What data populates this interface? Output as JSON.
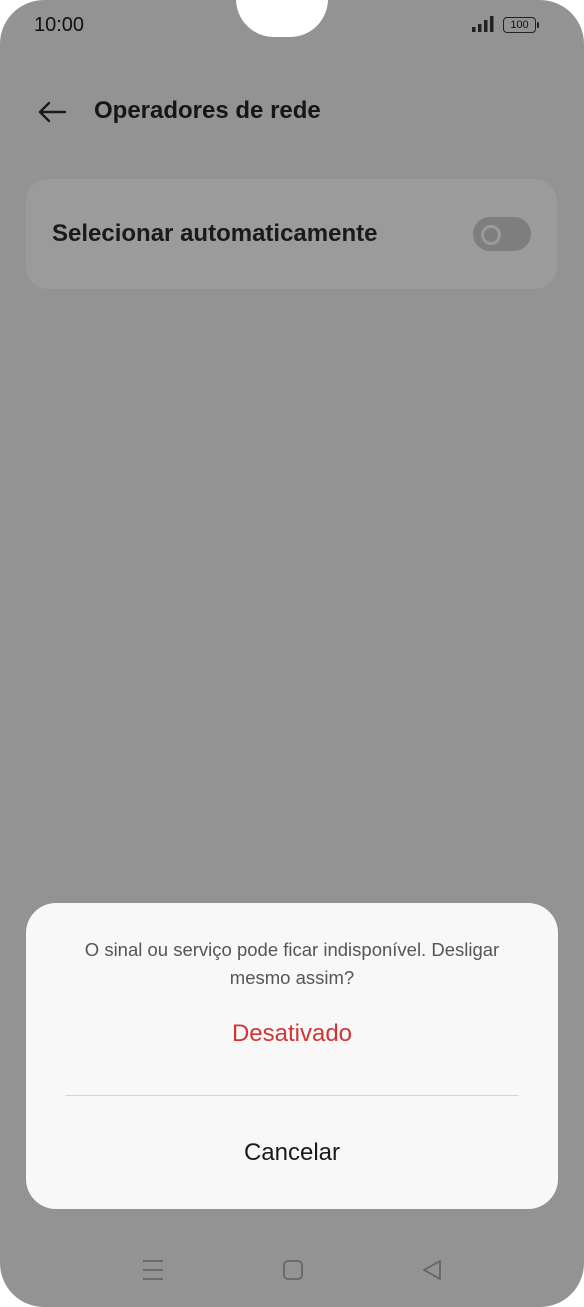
{
  "status_bar": {
    "time": "10:00",
    "battery": "100",
    "signal_icon": "signal-bars-icon"
  },
  "header": {
    "back_icon": "arrow-left-icon",
    "title": "Operadores de rede"
  },
  "setting": {
    "label": "Selecionar automaticamente",
    "toggle_on": false
  },
  "dialog": {
    "message": "O sinal ou serviço pode ficar indisponível. Desligar mesmo assim?",
    "confirm_label": "Desativado",
    "cancel_label": "Cancelar",
    "confirm_color": "#d33434"
  },
  "nav_bar": {
    "menu_icon": "menu-icon",
    "home_icon": "home-square-icon",
    "back_icon": "back-triangle-icon"
  }
}
